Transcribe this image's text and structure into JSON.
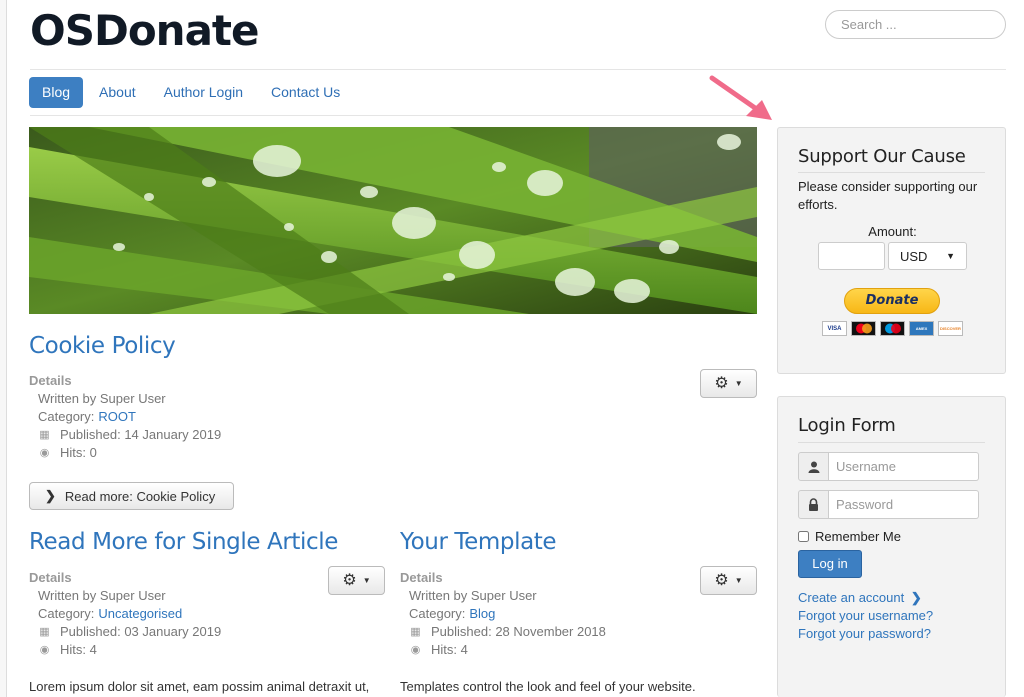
{
  "site": {
    "brand": "OSDonate"
  },
  "search": {
    "placeholder": "Search ..."
  },
  "nav": {
    "items": [
      {
        "label": "Blog"
      },
      {
        "label": "About"
      },
      {
        "label": "Author Login"
      },
      {
        "label": "Contact Us"
      }
    ]
  },
  "articles": [
    {
      "title": "Cookie Policy",
      "details": "Details",
      "written_by": "Written by Super User",
      "category_label": "Category:",
      "category": "ROOT",
      "published": "Published: 14 January 2019",
      "hits": "Hits: 0",
      "read_more": "Read more: Cookie Policy"
    },
    {
      "title": "Read More for Single Article",
      "details": "Details",
      "written_by": "Written by Super User",
      "category_label": "Category:",
      "category": "Uncategorised",
      "published": "Published: 03 January 2019",
      "hits": "Hits: 4",
      "excerpt": "Lorem ipsum dolor sit amet, eam possim animal detraxit ut,"
    },
    {
      "title": "Your Template",
      "details": "Details",
      "written_by": "Written by Super User",
      "category_label": "Category:",
      "category": "Blog",
      "published": "Published: 28 November 2018",
      "hits": "Hits: 4",
      "excerpt": "Templates control the look and feel of your website."
    }
  ],
  "support": {
    "title": "Support Our Cause",
    "text": "Please consider supporting our efforts.",
    "amount_label": "Amount:",
    "currency": "USD",
    "donate_label": "Donate",
    "cards": [
      "VISA",
      "MC",
      "MAESTRO",
      "AMEX",
      "DISCOVER"
    ]
  },
  "login": {
    "title": "Login Form",
    "username_placeholder": "Username",
    "password_placeholder": "Password",
    "remember": "Remember Me",
    "button": "Log in",
    "create_account": "Create an account",
    "forgot_username": "Forgot your username?",
    "forgot_password": "Forgot your password?"
  },
  "colors": {
    "accent": "#3d7fc2",
    "link": "#2f75bc",
    "arrow": "#f06b8a",
    "paypal_yellow": "#ffc439"
  }
}
